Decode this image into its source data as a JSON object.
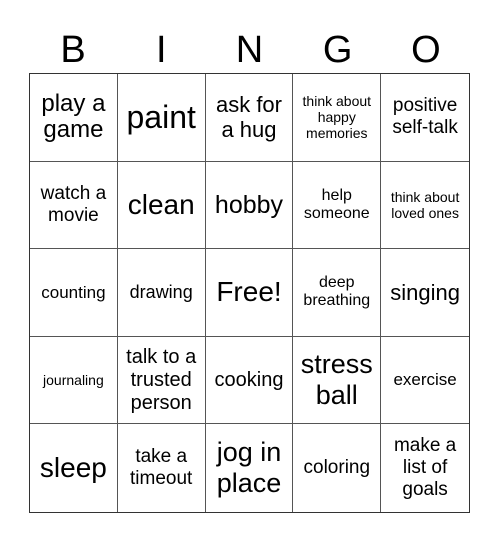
{
  "header": {
    "letters": [
      "B",
      "I",
      "N",
      "G",
      "O"
    ]
  },
  "cells": [
    "play a game",
    "paint",
    "ask for a hug",
    "think about happy memories",
    "positive self-talk",
    "watch a movie",
    "clean",
    "hobby",
    "help someone",
    "think about loved ones",
    "counting",
    "drawing",
    "Free!",
    "deep breathing",
    "singing",
    "journaling",
    "talk to a trusted person",
    "cooking",
    "stress ball",
    "exercise",
    "sleep",
    "take a timeout",
    "jog in place",
    "coloring",
    "make a list of goals"
  ]
}
